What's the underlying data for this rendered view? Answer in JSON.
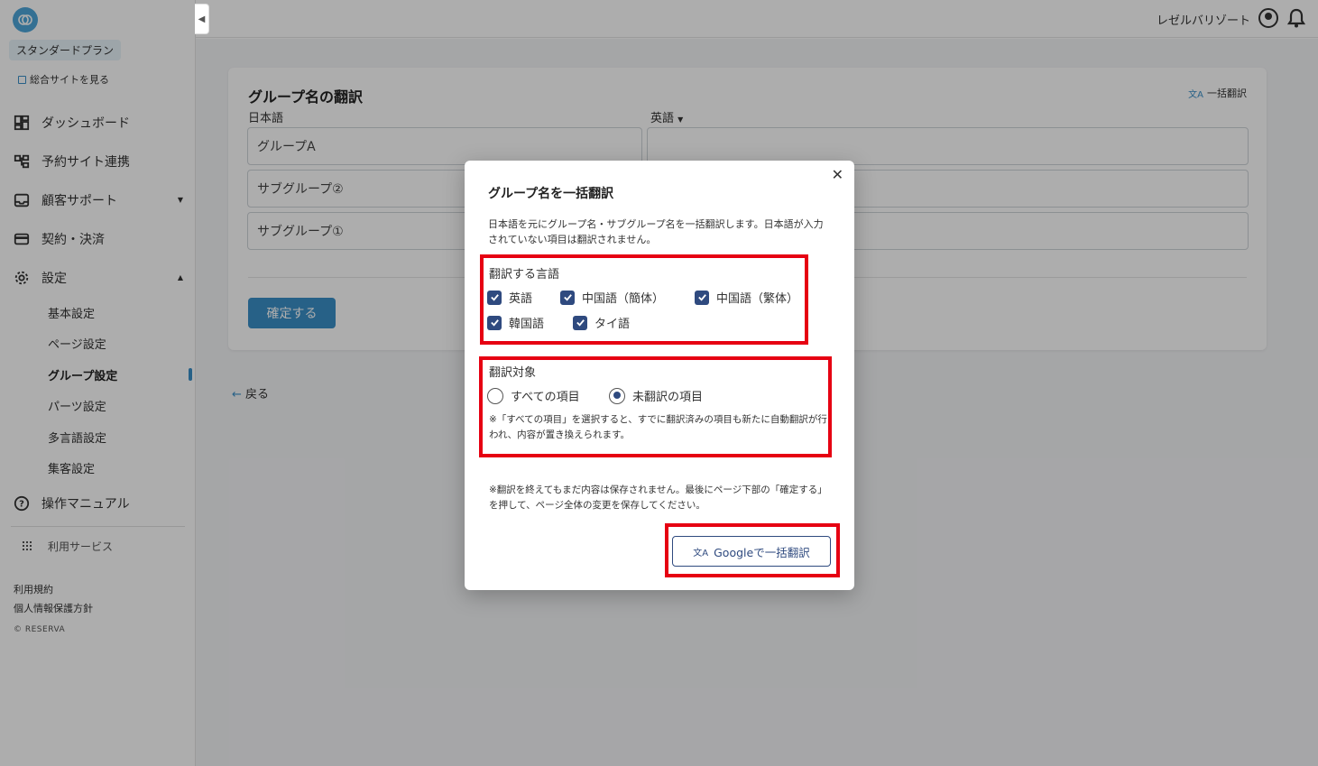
{
  "sidebar": {
    "plan": "スタンダードプラン",
    "site_link": "総合サイトを見る",
    "items": [
      {
        "label": "ダッシュボード"
      },
      {
        "label": "予約サイト連携"
      },
      {
        "label": "顧客サポート"
      },
      {
        "label": "契約・決済"
      },
      {
        "label": "設定"
      }
    ],
    "settings_sub": [
      "基本設定",
      "ページ設定",
      "グループ設定",
      "パーツ設定",
      "多言語設定",
      "集客設定"
    ],
    "manual": "操作マニュアル",
    "services": "利用サービス",
    "terms": "利用規約",
    "privacy": "個人情報保護方針",
    "copyright": "© RESERVA"
  },
  "topbar": {
    "user": "レゼルバリゾート"
  },
  "card": {
    "title": "グループ名の翻訳",
    "bulk_link": "一括翻訳",
    "col_ja": "日本語",
    "col_target": "英語",
    "rows": [
      {
        "ja": "グループA",
        "target": ""
      },
      {
        "ja": "サブグループ②",
        "target": ""
      },
      {
        "ja": "サブグループ①",
        "target": ""
      }
    ],
    "confirm": "確定する",
    "back": "戻る"
  },
  "modal": {
    "title": "グループ名を一括翻訳",
    "description": "日本語を元にグループ名・サブグループ名を一括翻訳します。日本語が入力されていない項目は翻訳されません。",
    "lang_section": "翻訳する言語",
    "languages": [
      {
        "label": "英語",
        "checked": true
      },
      {
        "label": "中国語（簡体）",
        "checked": true
      },
      {
        "label": "中国語（繁体）",
        "checked": true
      },
      {
        "label": "韓国語",
        "checked": true
      },
      {
        "label": "タイ語",
        "checked": true
      }
    ],
    "target_section": "翻訳対象",
    "targets": [
      {
        "label": "すべての項目",
        "selected": false
      },
      {
        "label": "未翻訳の項目",
        "selected": true
      }
    ],
    "target_note": "※「すべての項目」を選択すると、すでに翻訳済みの項目も新たに自動翻訳が行われ、内容が置き換えられます。",
    "save_note": "※翻訳を終えてもまだ内容は保存されません。最後にページ下部の「確定する」を押して、ページ全体の変更を保存してください。",
    "google_button": "Googleで一括翻訳"
  },
  "colors": {
    "accent": "#3a8fc7",
    "navy": "#2f4a7f",
    "highlight": "#e60012"
  }
}
